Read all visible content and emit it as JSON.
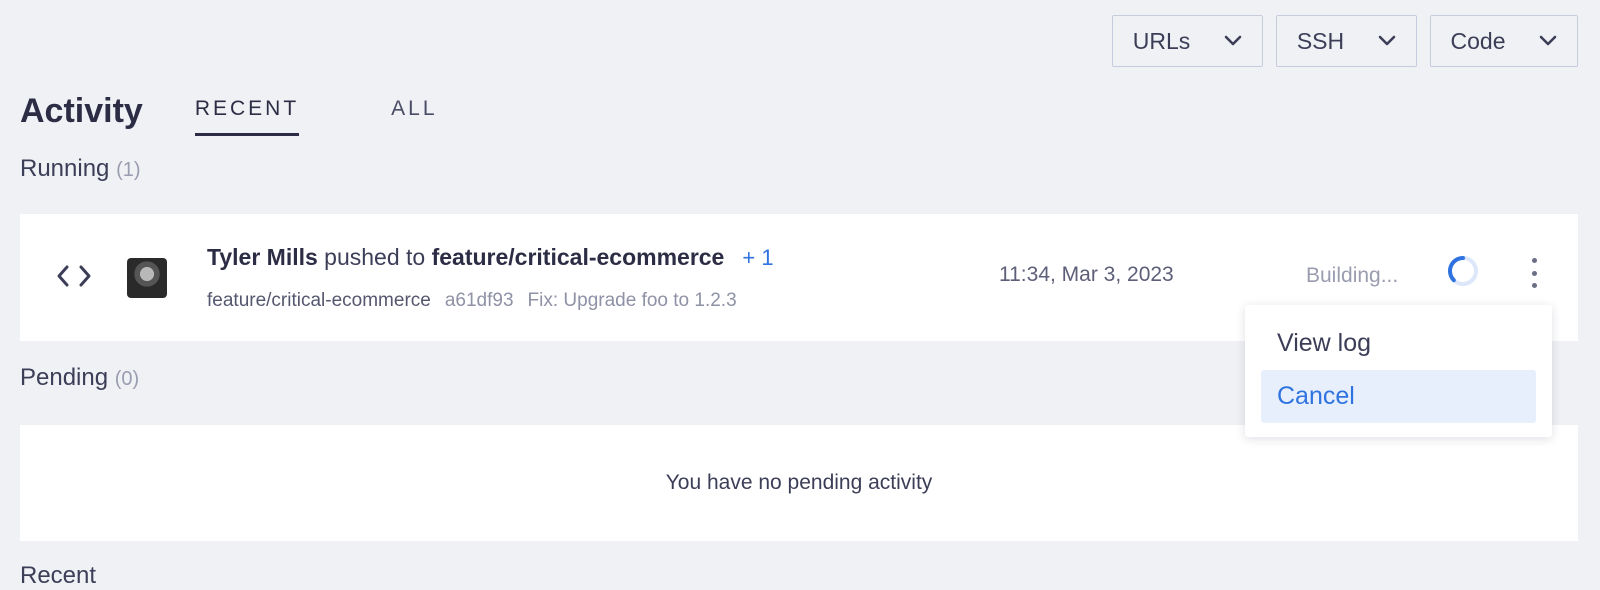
{
  "toolbar": {
    "urls_label": "URLs",
    "ssh_label": "SSH",
    "code_label": "Code"
  },
  "header": {
    "title": "Activity",
    "tabs": [
      {
        "label": "RECENT",
        "active": true
      },
      {
        "label": "ALL",
        "active": false
      }
    ]
  },
  "running": {
    "heading": "Running",
    "count": "(1)",
    "items": [
      {
        "author": "Tyler Mills",
        "action": "pushed to",
        "branch": "feature/critical-ecommerce",
        "extra": "+ 1",
        "branch_tag": "feature/critical-ecommerce",
        "hash": "a61df93",
        "message": "Fix: Upgrade foo to 1.2.3",
        "timestamp": "11:34, Mar 3, 2023",
        "status": "Building..."
      }
    ]
  },
  "pending": {
    "heading": "Pending",
    "count": "(0)",
    "empty_text": "You have no pending activity"
  },
  "recent": {
    "heading": "Recent"
  },
  "menu": {
    "items": [
      "View log",
      "Cancel"
    ]
  },
  "colors": {
    "background": "#f0f1f5",
    "accent": "#2f73e0",
    "menu_highlight": "#e7effd"
  },
  "icons": {
    "code": "code-icon",
    "chevron": "chevron-down-icon",
    "spinner": "spinner-icon",
    "kebab": "more-vertical-icon"
  }
}
